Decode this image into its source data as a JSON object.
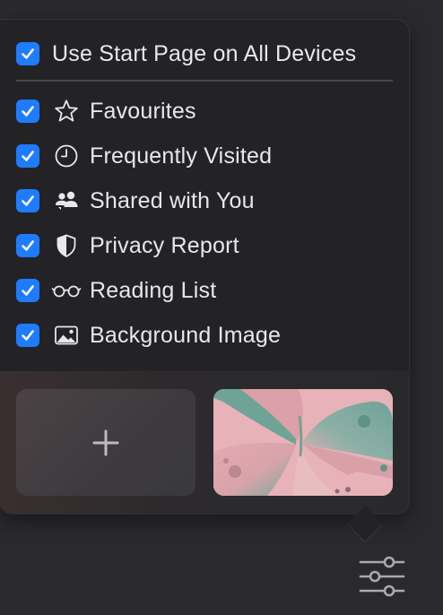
{
  "popover": {
    "sync_option": {
      "label": "Use Start Page on All Devices",
      "checked": true
    },
    "items": [
      {
        "label": "Favourites",
        "icon": "star-icon",
        "checked": true
      },
      {
        "label": "Frequently Visited",
        "icon": "clock-icon",
        "checked": true
      },
      {
        "label": "Shared with You",
        "icon": "shared-people-icon",
        "checked": true
      },
      {
        "label": "Privacy Report",
        "icon": "shield-icon",
        "checked": true
      },
      {
        "label": "Reading List",
        "icon": "glasses-icon",
        "checked": true
      },
      {
        "label": "Background Image",
        "icon": "image-icon",
        "checked": true
      }
    ],
    "background_tiles": [
      {
        "kind": "add",
        "icon": "plus-icon"
      },
      {
        "kind": "image",
        "image": "butterfly-wallpaper"
      }
    ]
  },
  "toolbar": {
    "settings_icon": "sliders-icon"
  },
  "colors": {
    "accent": "#1f7bff",
    "popover_bg": "#232326",
    "window_bg": "#2a2a2d",
    "text": "#e8e8ea"
  }
}
